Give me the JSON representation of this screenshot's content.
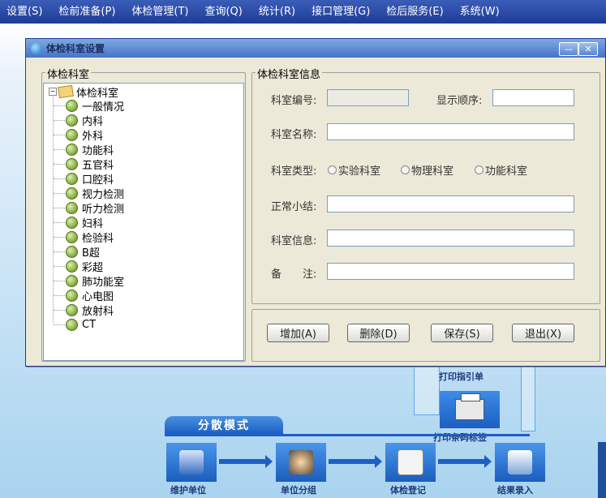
{
  "menubar": {
    "items": [
      "设置(S)",
      "检前准备(P)",
      "体检管理(T)",
      "查询(Q)",
      "统计(R)",
      "接口管理(G)",
      "检后服务(E)",
      "系统(W)"
    ]
  },
  "background_flow": {
    "print_guide": "打印指引单",
    "print_barcode": "打印条码标签",
    "mode_label": "分散模式",
    "steps": [
      "维护单位",
      "单位分组",
      "体检登记",
      "结果录入"
    ]
  },
  "dialog": {
    "title": "体检科室设置",
    "min_label": "—",
    "close_label": "✕"
  },
  "tree_panel": {
    "legend": "体检科室",
    "root": "体检科室",
    "items": [
      "一般情况",
      "内科",
      "外科",
      "功能科",
      "五官科",
      "口腔科",
      "视力检测",
      "听力检测",
      "妇科",
      "检验科",
      "B超",
      "彩超",
      "肺功能室",
      "心电图",
      "放射科",
      "CT"
    ]
  },
  "info_panel": {
    "legend": "体检科室信息",
    "dept_code_label": "科室编号:",
    "dept_code_value": "",
    "display_order_label": "显示顺序:",
    "display_order_value": "",
    "dept_name_label": "科室名称:",
    "dept_name_value": "",
    "dept_type_label": "科室类型:",
    "dept_type_options": [
      "实验科室",
      "物理科室",
      "功能科室"
    ],
    "normal_summary_label": "正常小结:",
    "normal_summary_value": "",
    "dept_info_label": "科室信息:",
    "dept_info_value": "",
    "remark_label": "备　　注:",
    "remark_value": ""
  },
  "buttons": {
    "add": "增加(A)",
    "delete": "删除(D)",
    "save": "保存(S)",
    "exit": "退出(X)"
  }
}
